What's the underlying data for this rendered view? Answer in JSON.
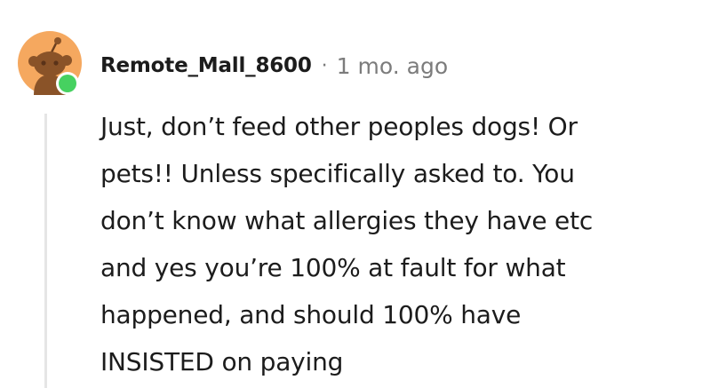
{
  "comment": {
    "username": "Remote_Mall_8600",
    "separator": "·",
    "timestamp": "1 mo. ago",
    "body_lines": [
      "Just, don’t feed other peoples dogs! Or",
      "pets!! Unless specifically asked to. You",
      "don’t know what allergies they have etc",
      "and yes you’re 100% at fault for what",
      "happened, and should 100% have",
      "INSISTED on paying"
    ],
    "avatar_icon": "snoo-avatar-icon",
    "status_icon": "online-status-icon"
  },
  "colors": {
    "avatar_background": "#f4a261",
    "online": "#46d160",
    "text": "#1c1c1c",
    "muted": "#7c7c7c",
    "thread_line": "#e5e5e5"
  }
}
